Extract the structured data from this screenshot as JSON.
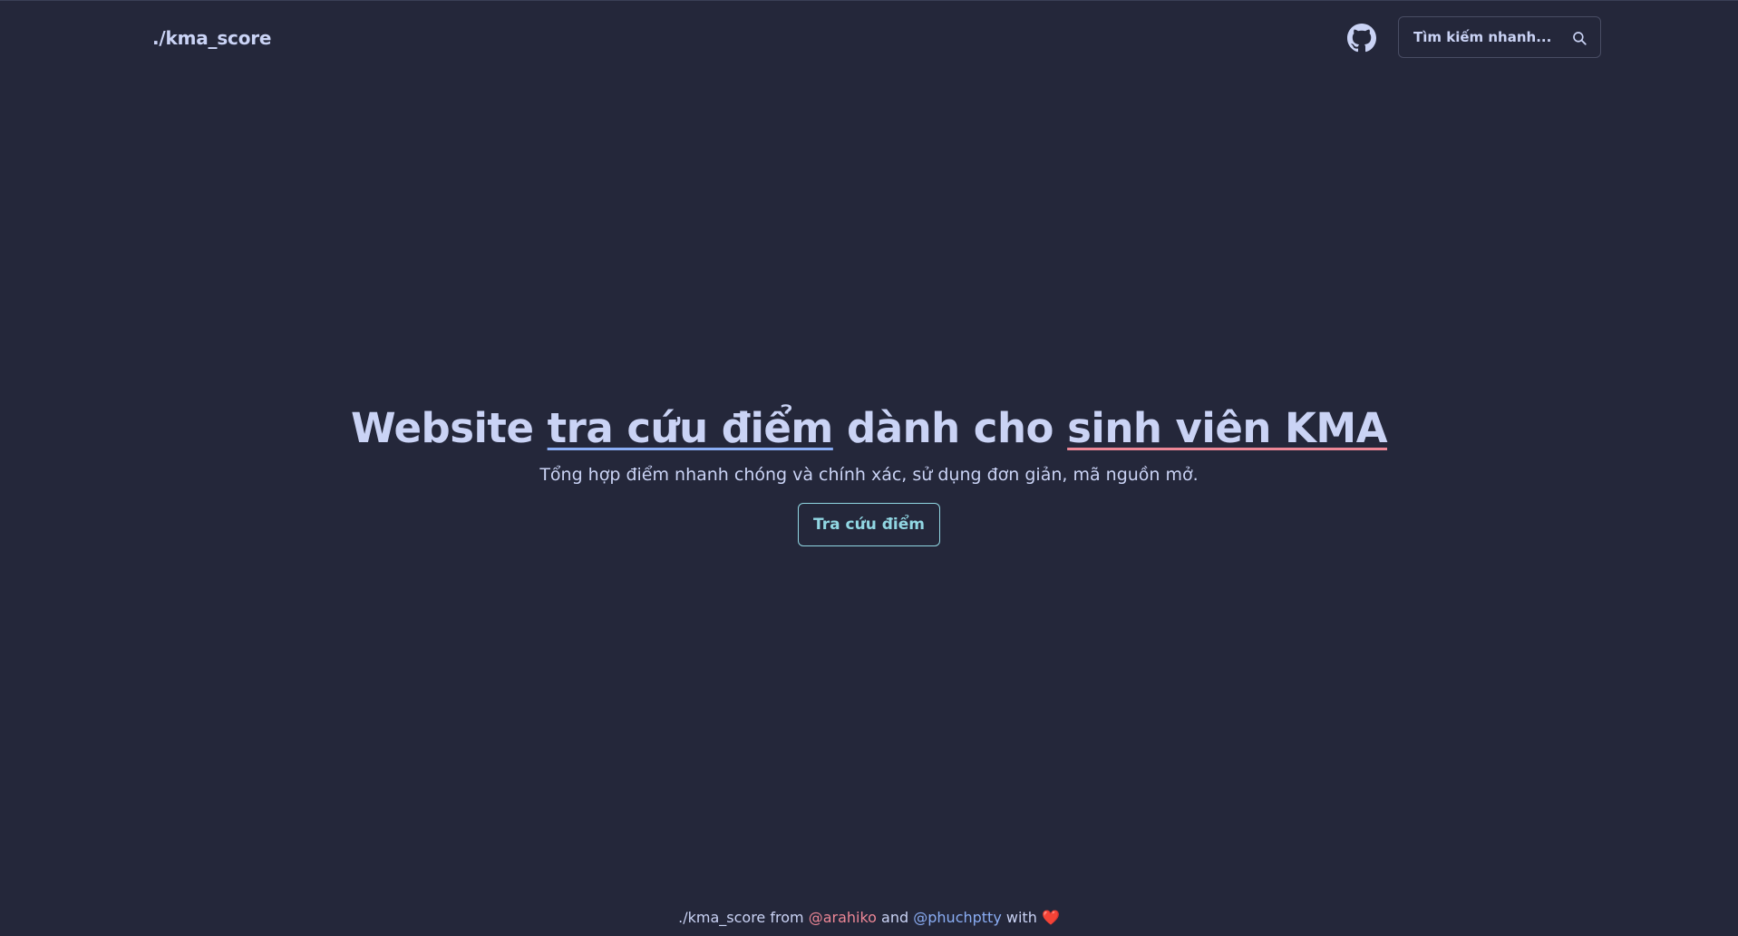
{
  "nav": {
    "brand": "./kma_score",
    "github_icon": "github-icon",
    "search": {
      "label": "Tìm kiếm nhanh...",
      "icon": "search-icon"
    }
  },
  "hero": {
    "headline": {
      "part1": "Website ",
      "highlight1": "tra cứu điểm",
      "part2": " dành cho ",
      "highlight2": "sinh viên KMA"
    },
    "subtitle": "Tổng hợp điểm nhanh chóng và chính xác, sử dụng đơn giản, mã nguồn mở.",
    "cta_label": "Tra cứu điểm"
  },
  "footer": {
    "brand": "./kma_score",
    "from": "from",
    "author1": "@arahiko",
    "and": "and",
    "author2": "@phuchptty",
    "with": "with",
    "heart": "❤️"
  },
  "colors": {
    "background": "#24273a",
    "text": "#cad3f5",
    "accent_blue": "#8aadf4",
    "accent_red": "#ed8796",
    "accent_teal": "#91d7e3"
  }
}
